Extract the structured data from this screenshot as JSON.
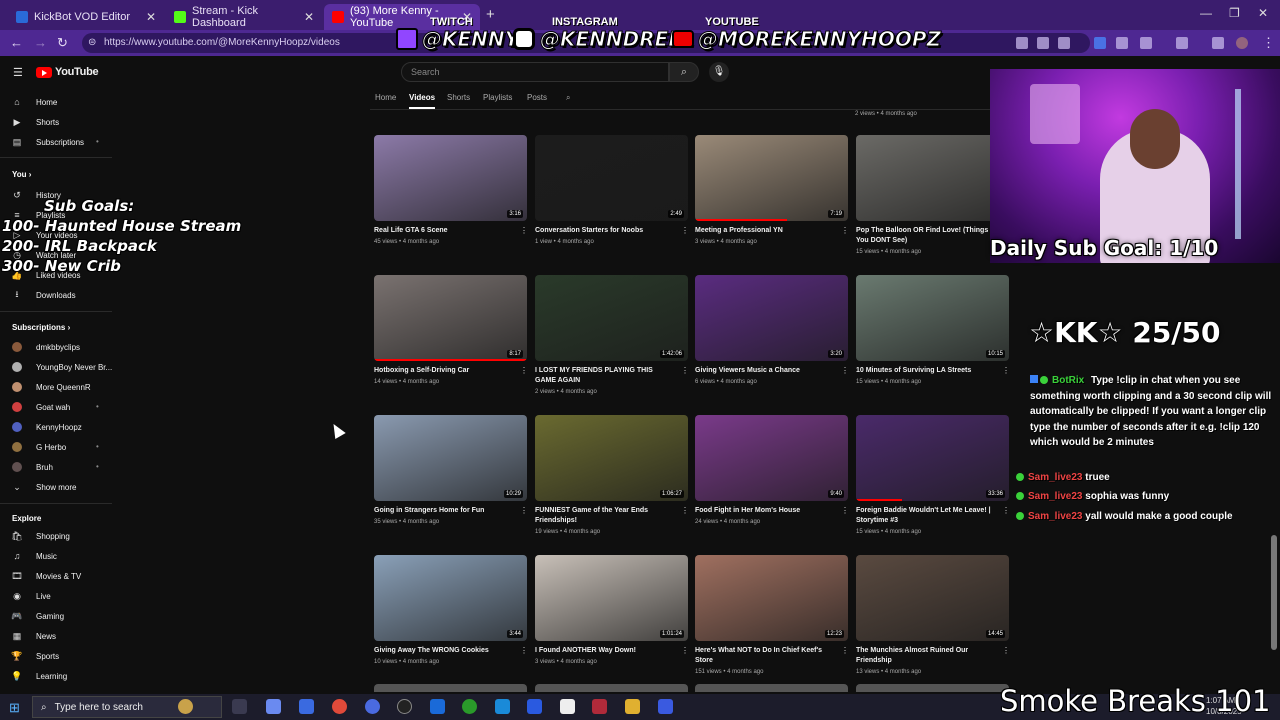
{
  "browser": {
    "tabs": [
      {
        "title": "KickBot VOD Editor",
        "favicon_color": "#2a6ad8"
      },
      {
        "title": "Stream - Kick Dashboard",
        "favicon_color": "#53fc18"
      },
      {
        "title": "(93) More Kenny - YouTube",
        "favicon_color": "#ff0000"
      }
    ],
    "url": "https://www.youtube.com/@MoreKennyHoopz/videos",
    "icons": [
      "back-icon",
      "forward-icon",
      "reload-icon",
      "site-info-icon",
      "new-tab-icon",
      "minimize-icon",
      "maximize-icon",
      "close-icon"
    ]
  },
  "socials": {
    "twitch_label": "TWITCH",
    "twitch_handle": "@KENNY",
    "instagram_label": "INSTAGRAM",
    "instagram_handle": "@KENNDRELL",
    "youtube_label": "YOUTUBE",
    "youtube_handle": "@MOREKENNYHOOPZ"
  },
  "youtube": {
    "logo_text": "YouTube",
    "search_placeholder": "Search",
    "sidebar": {
      "main": [
        {
          "label": "Home",
          "icon": "home-icon"
        },
        {
          "label": "Shorts",
          "icon": "shorts-icon"
        },
        {
          "label": "Subscriptions",
          "icon": "subscriptions-icon"
        }
      ],
      "you_heading": "You",
      "you_items": [
        {
          "label": "History",
          "icon": "history-icon"
        },
        {
          "label": "Playlists",
          "icon": "playlists-icon"
        },
        {
          "label": "Your videos",
          "icon": "your-videos-icon"
        },
        {
          "label": "Watch later",
          "icon": "watch-later-icon"
        },
        {
          "label": "Liked videos",
          "icon": "liked-icon"
        },
        {
          "label": "Downloads",
          "icon": "download-icon"
        }
      ],
      "subscriptions_heading": "Subscriptions",
      "subscriptions": [
        {
          "label": "dmkbbyclips",
          "color": "#8a5a3c"
        },
        {
          "label": "YoungBoy Never Br...",
          "color": "#b0b0b0"
        },
        {
          "label": "More QueennR",
          "color": "#c09070"
        },
        {
          "label": "Goat wah",
          "color": "#d04040"
        },
        {
          "label": "KennyHoopz",
          "color": "#5060c0"
        },
        {
          "label": "G Herbo",
          "color": "#907040"
        },
        {
          "label": "Bruh",
          "color": "#605050"
        }
      ],
      "show_more": "Show more",
      "explore_heading": "Explore",
      "explore": [
        {
          "label": "Shopping",
          "icon": "shopping-icon"
        },
        {
          "label": "Music",
          "icon": "music-icon"
        },
        {
          "label": "Movies & TV",
          "icon": "movies-icon"
        },
        {
          "label": "Live",
          "icon": "live-icon"
        },
        {
          "label": "Gaming",
          "icon": "gaming-icon"
        },
        {
          "label": "News",
          "icon": "news-icon"
        },
        {
          "label": "Sports",
          "icon": "sports-icon"
        },
        {
          "label": "Learning",
          "icon": "learning-icon"
        }
      ]
    },
    "channel_tabs": [
      "Home",
      "Videos",
      "Shorts",
      "Playlists",
      "Posts"
    ],
    "top_meta": "2 views • 4 months ago",
    "videos": [
      {
        "title": "Real Life GTA 6 Scene",
        "meta": "45 views • 4 months ago",
        "duration": "3:16",
        "color": "#8c7aa8",
        "progress": 0
      },
      {
        "title": "Conversation Starters for Noobs",
        "meta": "1 view • 4 months ago",
        "duration": "2:49",
        "color": "#1c1c1c",
        "progress": 0
      },
      {
        "title": "Meeting a Professional YN",
        "meta": "3 views • 4 months ago",
        "duration": "7:19",
        "color": "#9a8a78",
        "progress": 0.6
      },
      {
        "title": "Pop The Balloon OR Find Love! (Things You DONT See)",
        "meta": "15 views • 4 months ago",
        "duration": "",
        "color": "#6b6a66",
        "progress": 0
      },
      {
        "title": "Hotboxing a Self-Driving Car",
        "meta": "14 views • 4 months ago",
        "duration": "8:17",
        "color": "#7a7270",
        "progress": 1
      },
      {
        "title": "I LOST MY FRIENDS PLAYING THIS GAME AGAIN",
        "meta": "2 views • 4 months ago",
        "duration": "1:42:06",
        "color": "#2a3a2a",
        "progress": 0
      },
      {
        "title": "Giving Viewers Music a Chance",
        "meta": "6 views • 4 months ago",
        "duration": "3:20",
        "color": "#5a2c80",
        "progress": 0
      },
      {
        "title": "10 Minutes of Surviving LA Streets",
        "meta": "15 views • 4 months ago",
        "duration": "10:15",
        "color": "#6a7a70",
        "progress": 0
      },
      {
        "title": "Going in Strangers Home for Fun",
        "meta": "35 views • 4 months ago",
        "duration": "10:29",
        "color": "#8a9ab0",
        "progress": 0
      },
      {
        "title": "FUNNIEST Game of the Year Ends Friendships!",
        "meta": "19 views • 4 months ago",
        "duration": "1:06:27",
        "color": "#6a6a30",
        "progress": 0
      },
      {
        "title": "Food Fight in Her Mom's House",
        "meta": "24 views • 4 months ago",
        "duration": "9:40",
        "color": "#7a3a8a",
        "progress": 0
      },
      {
        "title": "Foreign Baddie Wouldn't Let Me Leave! | Storytime #3",
        "meta": "15 views • 4 months ago",
        "duration": "33:36",
        "color": "#4a2a6a",
        "progress": 0.3
      },
      {
        "title": "Giving Away The WRONG Cookies",
        "meta": "10 views • 4 months ago",
        "duration": "3:44",
        "color": "#8aa0b8",
        "progress": 0
      },
      {
        "title": "I Found ANOTHER Way Down!",
        "meta": "3 views • 4 months ago",
        "duration": "1:01:24",
        "color": "#c8c0b8",
        "progress": 0
      },
      {
        "title": "Here's What NOT to Do In Chief Keef's Store",
        "meta": "151 views • 4 months ago",
        "duration": "12:23",
        "color": "#a07060",
        "progress": 0
      },
      {
        "title": "The Munchies Almost Ruined Our Friendship",
        "meta": "13 views • 4 months ago",
        "duration": "14:45",
        "color": "#5a4a40",
        "progress": 0
      }
    ]
  },
  "overlay": {
    "sub_goals_title": "Sub Goals:",
    "sub_goals": [
      "100- Haunted House Stream",
      "200- IRL Backpack",
      "300- New Crib"
    ],
    "daily_sub_goal": "Daily Sub Goal: 1/10",
    "kk_goal": "☆KK☆ 25/50",
    "chat": [
      {
        "user": "BotRix",
        "text": "Type !clip in chat when you see something worth clipping and a 30 second clip will automatically be clipped! If you want a longer clip type the number of seconds after it e.g. !clip 120 which would be 2 minutes",
        "bot": true
      },
      {
        "user": "Sam_live23",
        "text": "truee"
      },
      {
        "user": "Sam_live23",
        "text": "sophia was funny"
      },
      {
        "user": "Sam_live23",
        "text": "yall would make a good couple"
      }
    ],
    "footer_text": "Smoke Breaks 101"
  },
  "taskbar": {
    "search_placeholder": "Type here to search",
    "time": "1:07 AM",
    "date": "10/8/2025"
  }
}
